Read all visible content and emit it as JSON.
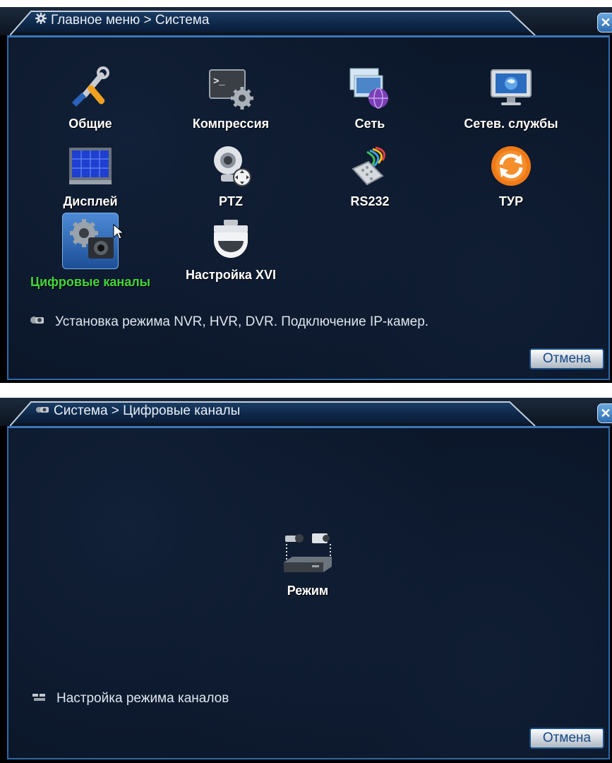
{
  "system_menu": {
    "title": "Главное меню > Система",
    "items": [
      {
        "label": "Общие",
        "icon": "tools-icon"
      },
      {
        "label": "Компрессия",
        "icon": "terminal-gear-icon"
      },
      {
        "label": "Сеть",
        "icon": "network-globe-icon"
      },
      {
        "label": "Сетев. службы",
        "icon": "monitor-globe-icon"
      },
      {
        "label": "Дисплей",
        "icon": "display-grid-icon"
      },
      {
        "label": "PTZ",
        "icon": "ptz-camera-icon"
      },
      {
        "label": "RS232",
        "icon": "rs232-connector-icon"
      },
      {
        "label": "ТУР",
        "icon": "tour-refresh-icon"
      },
      {
        "label": "Цифровые каналы",
        "icon": "digital-channels-icon",
        "selected": true
      },
      {
        "label": "Настройка XVI",
        "icon": "dome-camera-icon"
      }
    ],
    "hint": "Установка режима NVR, HVR, DVR. Подключение IP-камер.",
    "cancel_label": "Отмена"
  },
  "digital_channels": {
    "title": "Система > Цифровые каналы",
    "items": [
      {
        "label": "Режим",
        "icon": "mode-icon"
      }
    ],
    "hint": "Настройка режима каналов",
    "cancel_label": "Отмена"
  },
  "colors": {
    "selected_label": "#44d63a",
    "frame_blue": "#2f69a8",
    "background": "#0a1426"
  }
}
